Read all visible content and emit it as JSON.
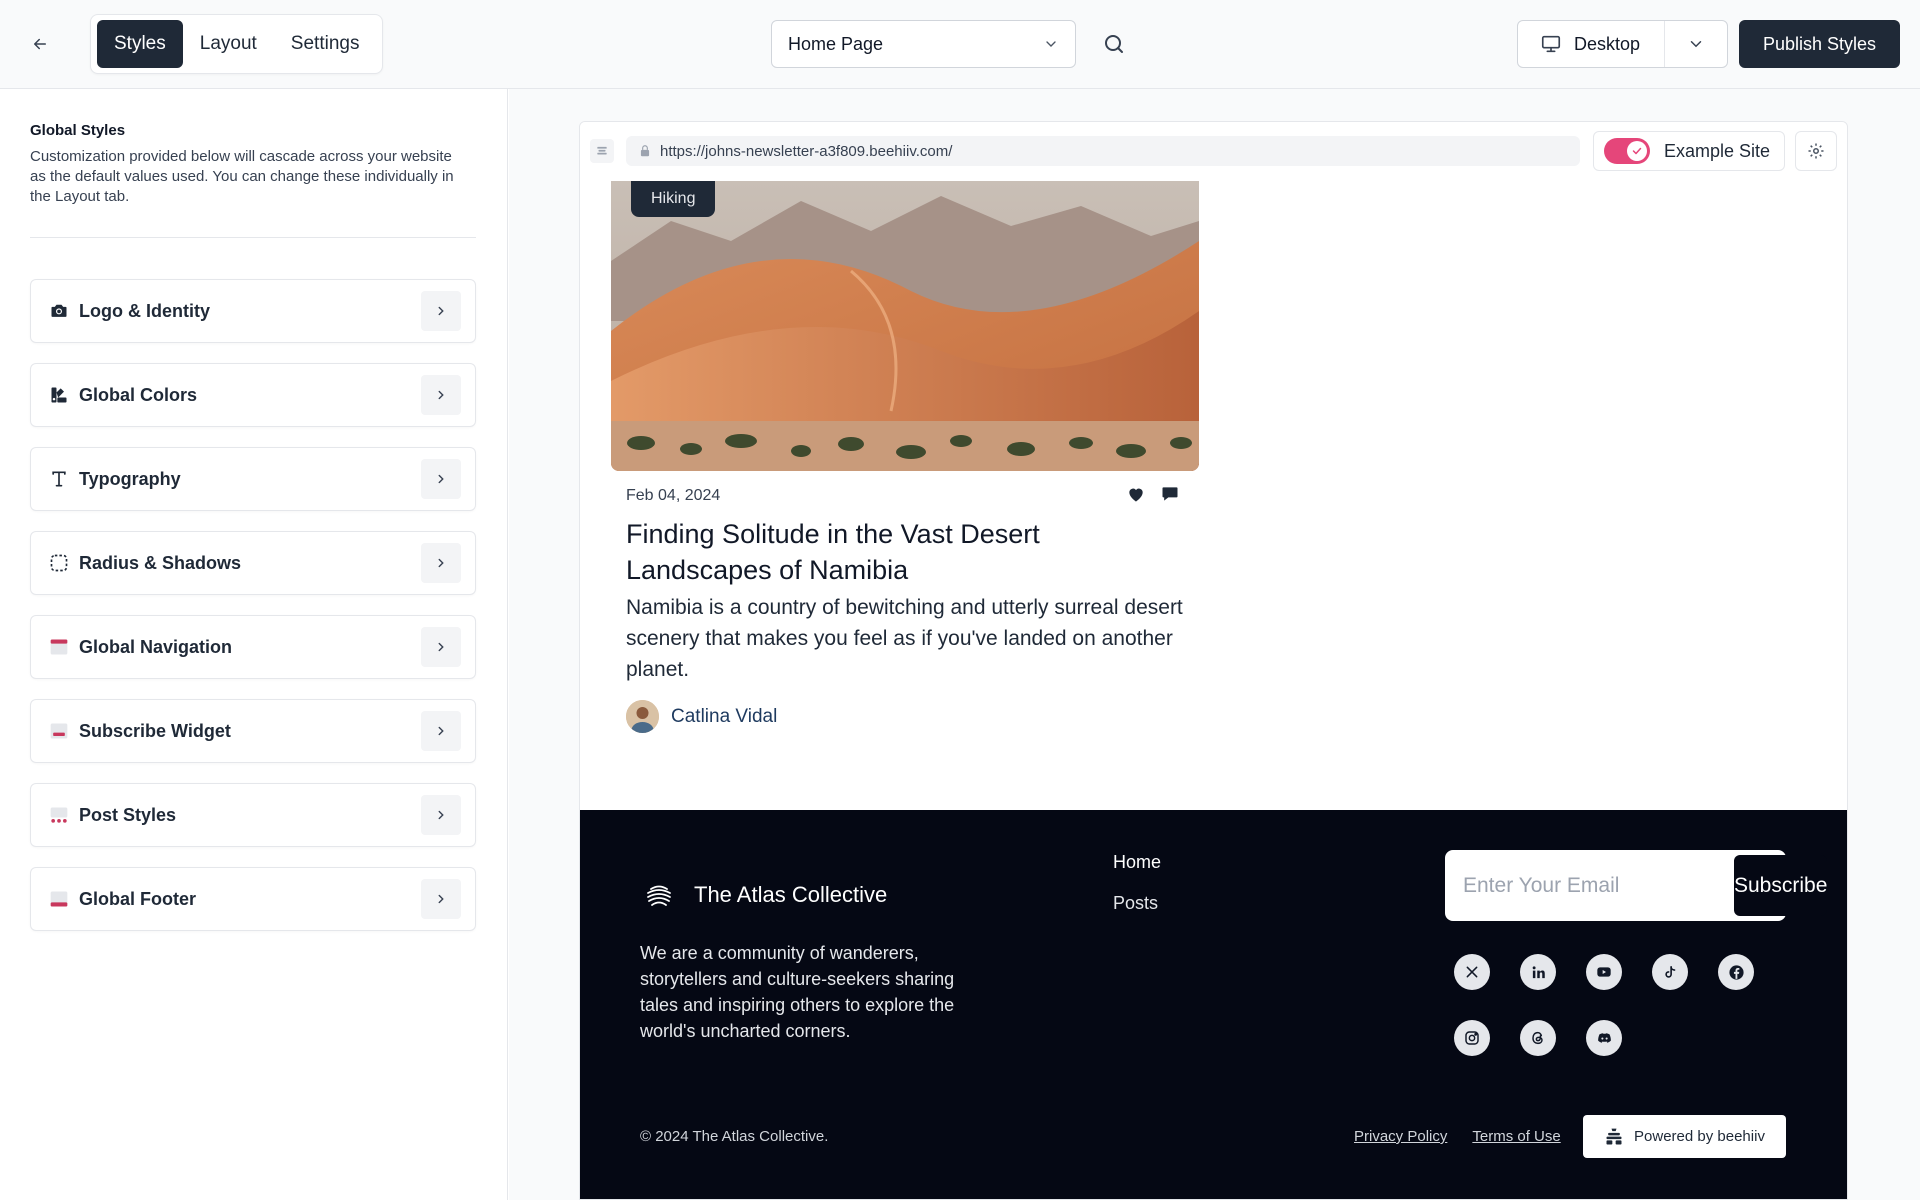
{
  "topbar": {
    "tabs": [
      {
        "label": "Styles"
      },
      {
        "label": "Layout"
      },
      {
        "label": "Settings"
      }
    ],
    "page_select": {
      "value": "Home Page"
    },
    "device": {
      "label": "Desktop"
    },
    "publish_label": "Publish Styles"
  },
  "sidebar": {
    "title": "Global Styles",
    "description": "Customization provided below will cascade across your website as the default values used. You can change these individually in the Layout tab.",
    "panels": [
      {
        "label": "Logo & Identity",
        "icon": "camera-icon"
      },
      {
        "label": "Global Colors",
        "icon": "palette-icon"
      },
      {
        "label": "Typography",
        "icon": "type-icon"
      },
      {
        "label": "Radius & Shadows",
        "icon": "radius-icon"
      },
      {
        "label": "Global Navigation",
        "icon": "navigation-icon"
      },
      {
        "label": "Subscribe Widget",
        "icon": "subscribe-widget-icon"
      },
      {
        "label": "Post Styles",
        "icon": "post-styles-icon"
      },
      {
        "label": "Global Footer",
        "icon": "footer-icon"
      }
    ]
  },
  "preview": {
    "url": "https://johns-newsletter-a3f809.beehiiv.com/",
    "example_site_label": "Example Site",
    "example_site_on": true,
    "accent_color": "#e5467a",
    "post": {
      "tag": "Hiking",
      "date": "Feb 04, 2024",
      "title": "Finding Solitude in the Vast Desert Landscapes of Namibia",
      "excerpt": "Namibia is a country of bewitching and utterly surreal desert scenery that makes you feel as if you've landed on another planet.",
      "author": "Catlina Vidal"
    },
    "footer": {
      "brand": "The Atlas Collective",
      "about": "We are a community of wanderers, storytellers and culture-seekers sharing tales and inspiring others to explore the world's uncharted corners.",
      "nav": {
        "home": "Home",
        "posts": "Posts"
      },
      "email_placeholder": "Enter Your Email",
      "subscribe_label": "Subscribe",
      "socials": [
        "x-icon",
        "linkedin-icon",
        "youtube-icon",
        "tiktok-icon",
        "facebook-icon",
        "instagram-icon",
        "threads-icon",
        "discord-icon"
      ],
      "copyright": "© 2024 The Atlas Collective.",
      "privacy": "Privacy Policy",
      "terms": "Terms of Use",
      "powered": "Powered by beehiiv",
      "background": "#050814"
    }
  }
}
